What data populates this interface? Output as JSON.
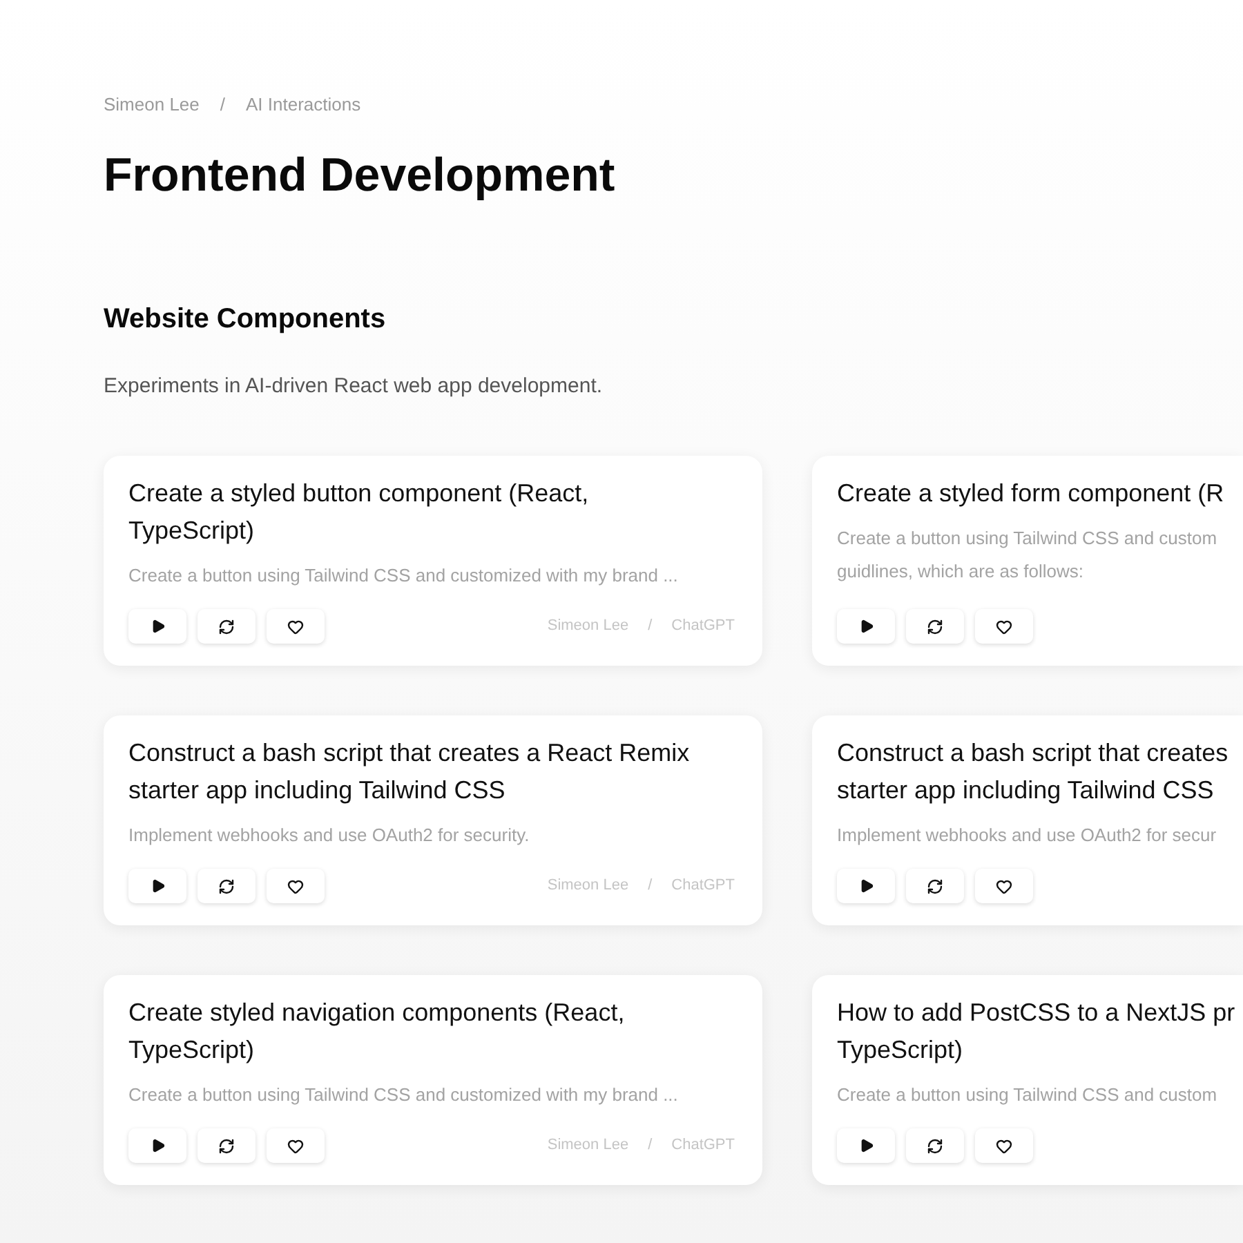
{
  "breadcrumb": {
    "items": [
      "Simeon Lee",
      "AI Interactions"
    ],
    "separator": "/"
  },
  "page_title": "Frontend Development",
  "section": {
    "heading": "Website Components",
    "description": "Experiments in AI-driven React web app development."
  },
  "cards": [
    {
      "title_lines": [
        "Create a styled button component (React,",
        "TypeScript)"
      ],
      "description_lines": [
        "Create a button using Tailwind CSS and customized with my brand ..."
      ],
      "meta": {
        "author": "Simeon Lee",
        "separator": "/",
        "model": "ChatGPT"
      }
    },
    {
      "title_lines": [
        "Create a styled form component (R"
      ],
      "description_lines": [
        "Create a button using Tailwind CSS and custom",
        "guidlines, which are as follows:"
      ]
    },
    {
      "title_lines": [
        "Construct a bash script that creates a React Remix",
        "starter app including Tailwind CSS"
      ],
      "description_lines": [
        "Implement webhooks and use OAuth2 for security."
      ],
      "meta": {
        "author": "Simeon Lee",
        "separator": "/",
        "model": "ChatGPT"
      }
    },
    {
      "title_lines": [
        "Construct a bash script that creates",
        "starter app including Tailwind CSS"
      ],
      "description_lines": [
        "Implement webhooks and use OAuth2 for secur"
      ]
    },
    {
      "title_lines": [
        "Create styled navigation components (React,",
        "TypeScript)"
      ],
      "description_lines": [
        "Create a button using Tailwind CSS and customized with my brand ..."
      ],
      "meta": {
        "author": "Simeon Lee",
        "separator": "/",
        "model": "ChatGPT"
      }
    },
    {
      "title_lines": [
        "How to add PostCSS to a NextJS pr",
        "TypeScript)"
      ],
      "description_lines": [
        "Create a button using Tailwind CSS and custom"
      ]
    }
  ]
}
